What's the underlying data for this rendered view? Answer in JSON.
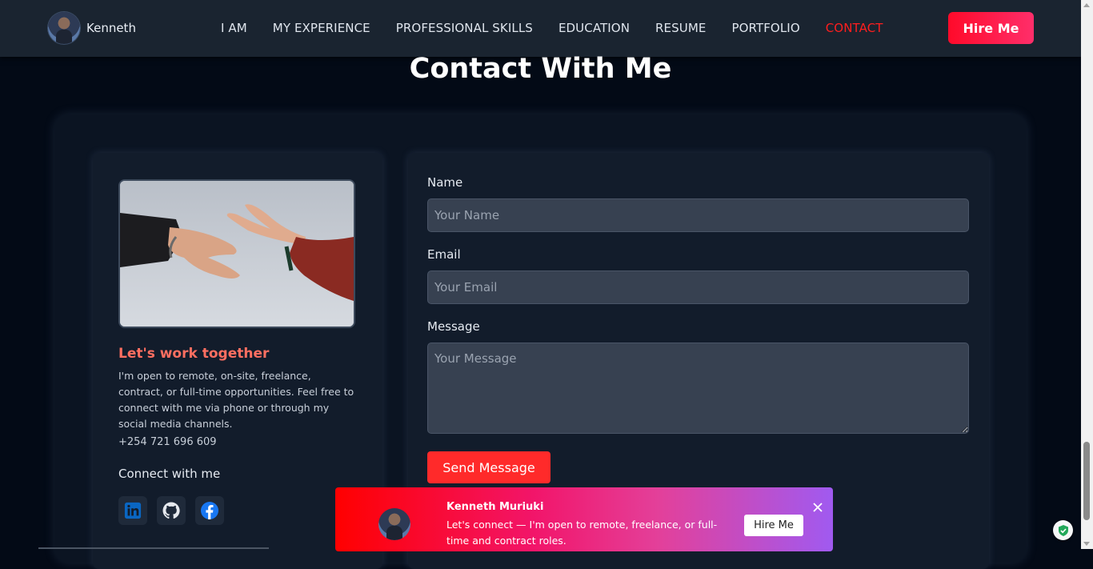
{
  "nav": {
    "brand_name": "Kenneth",
    "items": [
      {
        "label": "I AM",
        "active": false
      },
      {
        "label": "MY EXPERIENCE",
        "active": false
      },
      {
        "label": "PROFESSIONAL SKILLS",
        "active": false
      },
      {
        "label": "EDUCATION",
        "active": false
      },
      {
        "label": "RESUME",
        "active": false
      },
      {
        "label": "PORTFOLIO",
        "active": false
      },
      {
        "label": "CONTACT",
        "active": true
      }
    ],
    "hire_label": "Hire Me"
  },
  "section": {
    "title": "Contact With Me"
  },
  "info": {
    "title": "Let's work together",
    "text": "I'm open to remote, on-site, freelance, contract, or full-time opportunities. Feel free to connect with me via phone or through my social media channels.",
    "phone": "+254 721 696 609",
    "connect_label": "Connect with me",
    "socials": [
      "linkedin-icon",
      "github-icon",
      "facebook-icon"
    ]
  },
  "form": {
    "name_label": "Name",
    "name_placeholder": "Your Name",
    "email_label": "Email",
    "email_placeholder": "Your Email",
    "message_label": "Message",
    "message_placeholder": "Your Message",
    "submit_label": "Send Message"
  },
  "toast": {
    "name": "Kenneth Muriuki",
    "message": "Let's connect — I'm open to remote, freelance, or full-time and contract roles.",
    "button_label": "Hire Me"
  },
  "colors": {
    "accent": "#ff2a2a",
    "nav_active": "#ff1e1e",
    "heading_accent": "#ff6f61",
    "background": "#030a16",
    "card": "#121c2b",
    "input": "#374151"
  }
}
